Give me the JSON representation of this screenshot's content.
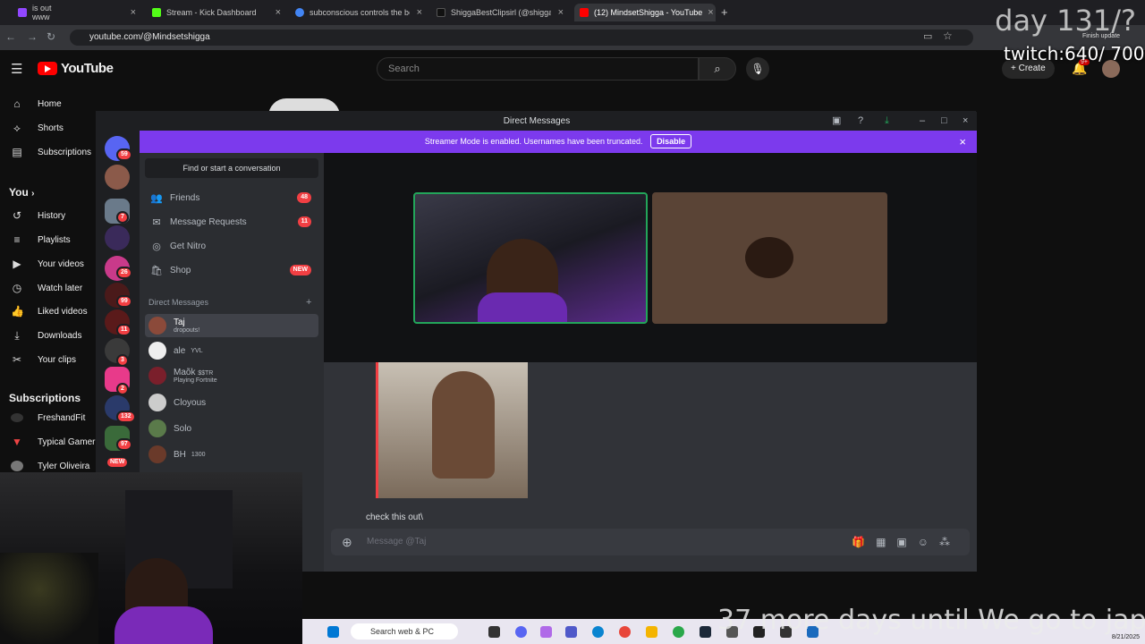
{
  "browser": {
    "tabs": [
      {
        "label": "is out",
        "sub": "www",
        "color": "#9147ff"
      },
      {
        "label": "Stream - Kick Dashboard",
        "color": "#53fc18"
      },
      {
        "label": "subconscious controls the body",
        "color": "#4285f4"
      },
      {
        "label": "ShiggaBestClipsirl (@shiggabe",
        "color": "#111111"
      },
      {
        "label": "(12) MindsetShigga - YouTube",
        "color": "#ff0000"
      }
    ],
    "url": "youtube.com/@Mindsetshigga",
    "finish_update": "Finish update"
  },
  "youtube": {
    "logo": "YouTube",
    "search_placeholder": "Search",
    "create_label": "Create",
    "notif_count": "9+",
    "nav": [
      {
        "label": "Home",
        "icon": "home-icon"
      },
      {
        "label": "Shorts",
        "icon": "shorts-icon"
      },
      {
        "label": "Subscriptions",
        "icon": "subscriptions-icon"
      }
    ],
    "you_header": "You",
    "you_items": [
      {
        "label": "History",
        "icon": "history-icon"
      },
      {
        "label": "Playlists",
        "icon": "playlists-icon"
      },
      {
        "label": "Your videos",
        "icon": "your-videos-icon"
      },
      {
        "label": "Watch later",
        "icon": "watch-later-icon"
      },
      {
        "label": "Liked videos",
        "icon": "liked-videos-icon"
      },
      {
        "label": "Downloads",
        "icon": "downloads-icon"
      },
      {
        "label": "Your clips",
        "icon": "clips-icon"
      }
    ],
    "subs_header": "Subscriptions",
    "subs": [
      "FreshandFit",
      "Typical Gamer",
      "Tyler Oliveira"
    ]
  },
  "overlays": {
    "day": "day 131/?",
    "twitch": "twitch:640/ 700",
    "japan": "37 more days until We go to japan"
  },
  "discord": {
    "title": "Direct Messages",
    "banner": "Streamer Mode is enabled. Usernames have been truncated.",
    "banner_button": "Disable",
    "guild_badges": [
      "59",
      "7",
      "26",
      "99",
      "11",
      "3",
      "2",
      "132",
      "97",
      "NEW"
    ],
    "find": "Find or start a conversation",
    "nav": [
      {
        "label": "Friends",
        "badge": "48",
        "icon": "friends-icon"
      },
      {
        "label": "Message Requests",
        "badge": "11",
        "icon": "message-requests-icon"
      },
      {
        "label": "Get Nitro",
        "badge": "",
        "icon": "nitro-icon"
      },
      {
        "label": "Shop",
        "badge": "NEW",
        "icon": "shop-icon"
      }
    ],
    "dm_header": "Direct Messages",
    "dms": [
      {
        "name": "Taj",
        "sub": "dropouts!",
        "color": "#8b4a3a",
        "selected": true
      },
      {
        "name": "ale",
        "tag": "YVL",
        "sub": "",
        "color": "#eeeeee"
      },
      {
        "name": "Maõk",
        "tag": "$$TR",
        "sub": "Playing Fortnite",
        "color": "#7a1f2b"
      },
      {
        "name": "Cloyous",
        "sub": "",
        "color": "#cccccc"
      },
      {
        "name": "Solo",
        "sub": "",
        "color": "#5a7a4a"
      },
      {
        "name": "BH",
        "tag": "1300",
        "sub": "",
        "color": "#6a3a2a"
      }
    ],
    "message": "check this out\\",
    "input_placeholder": "Message @Taj"
  },
  "taskbar": {
    "search": "Search web & PC",
    "date": "8/21/2025"
  }
}
